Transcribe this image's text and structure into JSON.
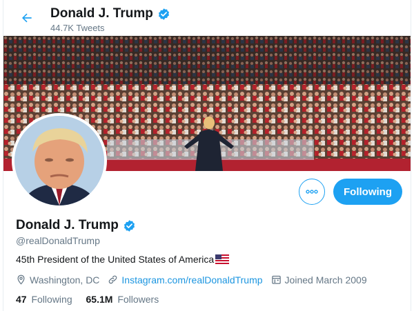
{
  "header": {
    "name": "Donald J. Trump",
    "tweet_count": "44.7K Tweets"
  },
  "profile": {
    "name": "Donald J. Trump",
    "handle": "@realDonaldTrump",
    "bio": "45th President of the United States of America",
    "location": "Washington, DC",
    "website": "Instagram.com/realDonaldTrump",
    "joined": "Joined March 2009",
    "following_count": "47",
    "following_label": "Following",
    "followers_count": "65.1M",
    "followers_label": "Followers"
  },
  "actions": {
    "follow_label": "Following"
  },
  "colors": {
    "accent": "#1da1f2",
    "link": "#1b95e0",
    "muted": "#657786",
    "text": "#14171a"
  },
  "icons": [
    "back-arrow-icon",
    "verified-badge-icon",
    "more-icon",
    "location-pin-icon",
    "link-icon",
    "calendar-icon",
    "us-flag-icon"
  ]
}
